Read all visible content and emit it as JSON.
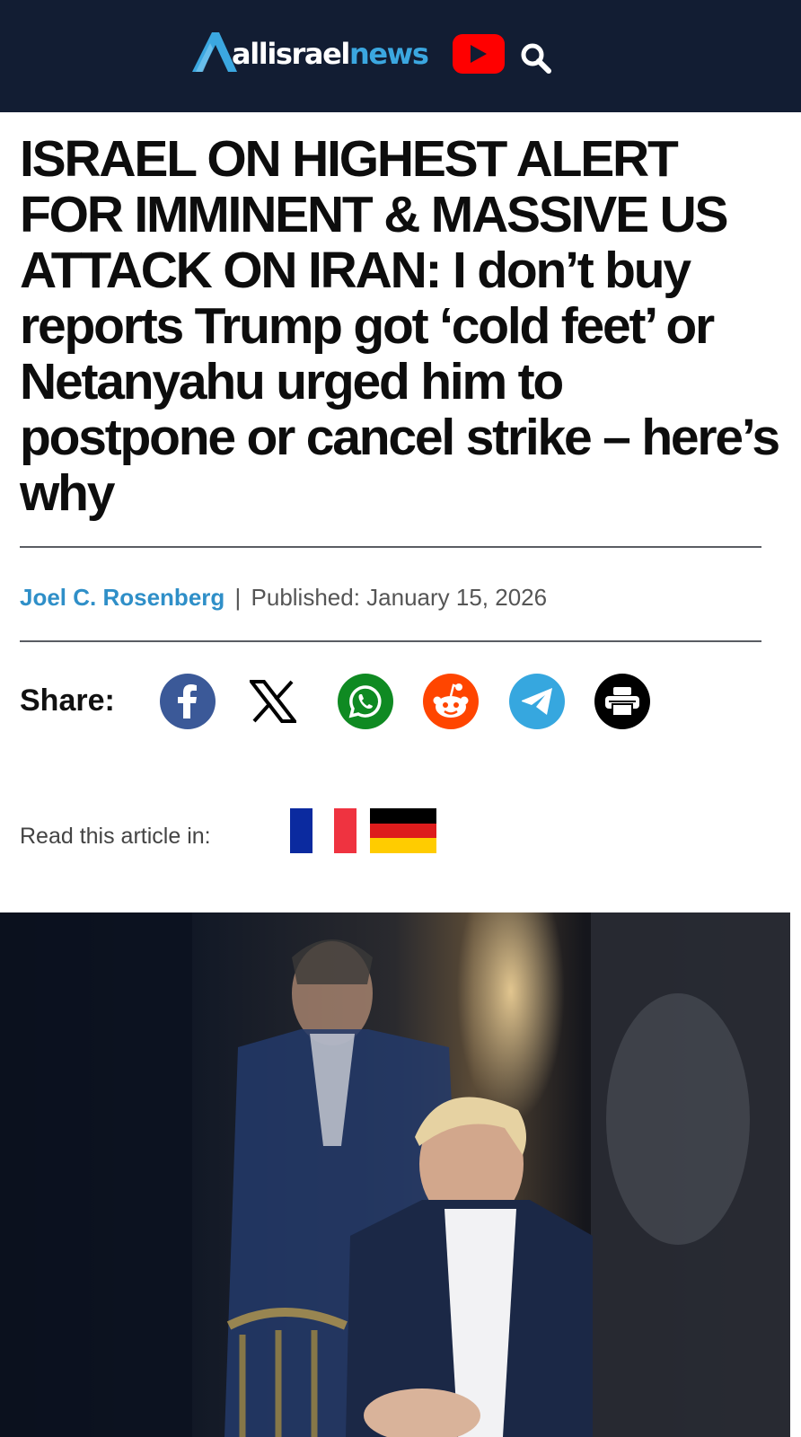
{
  "header": {
    "logo": {
      "text_main": "allisrael",
      "text_accent": "news",
      "colors": {
        "main": "#ffffff",
        "accent": "#3ba7e0",
        "background": "#121d33"
      }
    },
    "youtube_icon": "youtube-icon",
    "search_icon": "search-icon"
  },
  "article": {
    "headline": "ISRAEL ON HIGHEST ALERT FOR IMMINENT & MASSIVE US ATTACK ON IRAN: I don’t buy reports Trump got ‘cold feet’ or Netanyahu urged him to postpone or cancel strike – here’s why",
    "author": "Joel C. Rosenberg",
    "separator": "|",
    "published": "Published: January 15, 2026"
  },
  "share": {
    "label": "Share:",
    "buttons": [
      {
        "icon": "facebook-icon",
        "color": "#3b5998"
      },
      {
        "icon": "x-icon",
        "color": "#ffffff"
      },
      {
        "icon": "whatsapp-icon",
        "color": "#0f8a22"
      },
      {
        "icon": "reddit-icon",
        "color": "#ff4500"
      },
      {
        "icon": "telegram-icon",
        "color": "#36a7df"
      },
      {
        "icon": "print-icon",
        "color": "#000000"
      }
    ]
  },
  "translations": {
    "label": "Read this article in:",
    "flags": [
      "france-flag",
      "germany-flag"
    ]
  },
  "hero_image": {
    "subject": "photo-of-two-men-in-suits"
  }
}
